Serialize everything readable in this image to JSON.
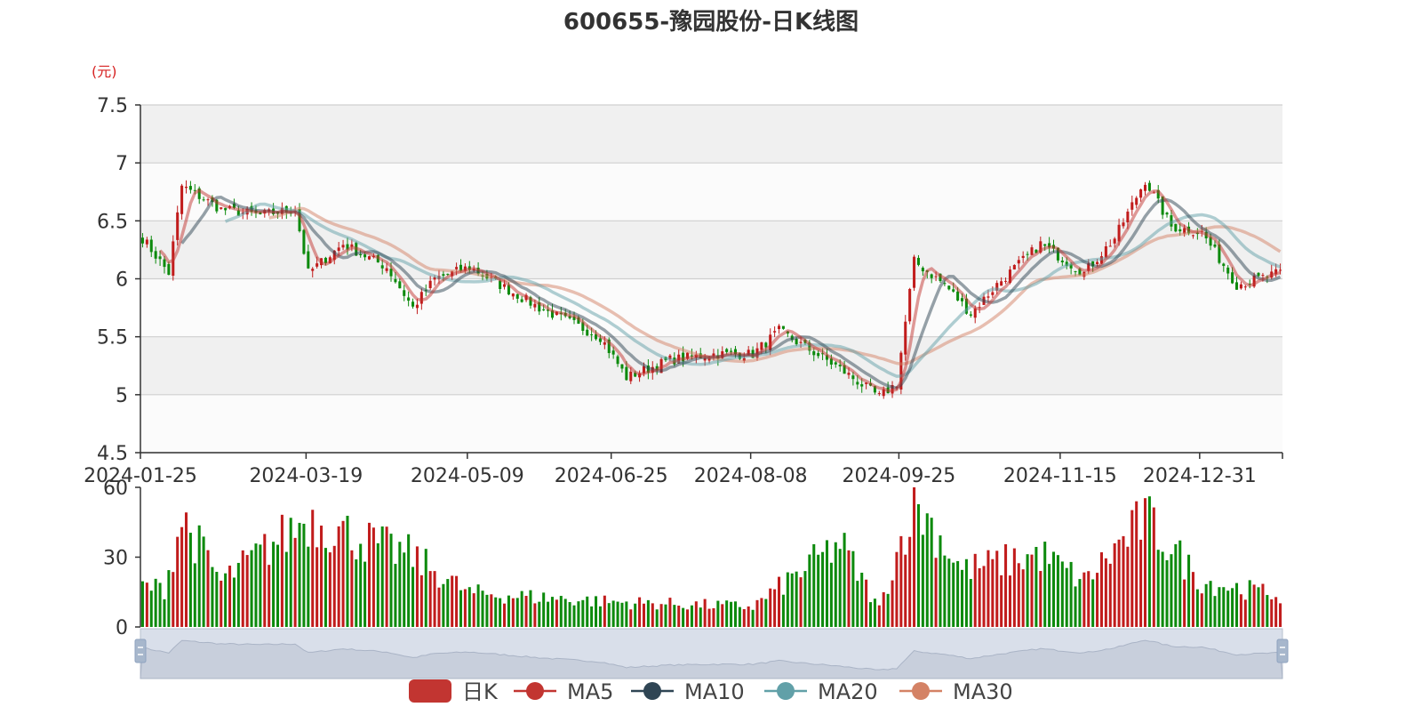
{
  "chart_data": [
    {
      "type": "candlestick",
      "title": "600655-豫园股份-日K线图",
      "unit": "(元)",
      "xaxis_ticks": [
        "2024-01-25",
        "2024-03-19",
        "2024-05-09",
        "2024-06-25",
        "2024-08-08",
        "2024-09-25",
        "2024-11-15",
        "2024-12-31"
      ],
      "yaxis_ticks": [
        "4.5",
        "5",
        "5.5",
        "6",
        "6.5",
        "7",
        "7.5"
      ],
      "ylim": [
        4.5,
        7.5
      ],
      "grid": true,
      "legend_position": "bottom",
      "legend": [
        {
          "name": "日K",
          "color": "#c23531"
        },
        {
          "name": "MA5",
          "color": "#c23531"
        },
        {
          "name": "MA10",
          "color": "#2f4554"
        },
        {
          "name": "MA20",
          "color": "#61a0a8"
        },
        {
          "name": "MA30",
          "color": "#d48265"
        }
      ],
      "colors": {
        "up": "#c11c1c",
        "down": "#0d8a0d"
      },
      "anchors": [
        {
          "date": "2024-01-25",
          "close": 6.35
        },
        {
          "date": "2024-02-02",
          "close": 6.05
        },
        {
          "date": "2024-02-07",
          "close": 6.8
        },
        {
          "date": "2024-02-20",
          "close": 6.6
        },
        {
          "date": "2024-03-04",
          "close": 6.55
        },
        {
          "date": "2024-03-14",
          "close": 6.6
        },
        {
          "date": "2024-03-19",
          "close": 6.05
        },
        {
          "date": "2024-03-29",
          "close": 6.3
        },
        {
          "date": "2024-04-12",
          "close": 6.1
        },
        {
          "date": "2024-04-22",
          "close": 5.75
        },
        {
          "date": "2024-04-29",
          "close": 6.0
        },
        {
          "date": "2024-05-09",
          "close": 6.1
        },
        {
          "date": "2024-05-31",
          "close": 5.75
        },
        {
          "date": "2024-06-20",
          "close": 5.5
        },
        {
          "date": "2024-06-28",
          "close": 5.15
        },
        {
          "date": "2024-07-12",
          "close": 5.3
        },
        {
          "date": "2024-07-26",
          "close": 5.35
        },
        {
          "date": "2024-08-08",
          "close": 5.35
        },
        {
          "date": "2024-08-16",
          "close": 5.55
        },
        {
          "date": "2024-09-04",
          "close": 5.25
        },
        {
          "date": "2024-09-18",
          "close": 4.98
        },
        {
          "date": "2024-09-24",
          "close": 5.1
        },
        {
          "date": "2024-09-30",
          "close": 6.15
        },
        {
          "date": "2024-10-09",
          "close": 5.95
        },
        {
          "date": "2024-10-17",
          "close": 5.7
        },
        {
          "date": "2024-10-25",
          "close": 5.95
        },
        {
          "date": "2024-11-08",
          "close": 6.3
        },
        {
          "date": "2024-11-22",
          "close": 6.05
        },
        {
          "date": "2024-12-03",
          "close": 6.35
        },
        {
          "date": "2024-12-12",
          "close": 6.85
        },
        {
          "date": "2024-12-20",
          "close": 6.45
        },
        {
          "date": "2024-12-31",
          "close": 6.4
        },
        {
          "date": "2025-01-10",
          "close": 5.95
        },
        {
          "date": "2025-01-24",
          "close": 6.05
        }
      ]
    },
    {
      "type": "bar",
      "name": "volume",
      "yaxis_ticks": [
        "0",
        "30",
        "60"
      ],
      "ylim": [
        0,
        60
      ],
      "volume_anchors": [
        {
          "date": "2024-01-25",
          "value": 18
        },
        {
          "date": "2024-02-01",
          "value": 17
        },
        {
          "date": "2024-02-07",
          "value": 48
        },
        {
          "date": "2024-02-20",
          "value": 20
        },
        {
          "date": "2024-03-19",
          "value": 48
        },
        {
          "date": "2024-04-10",
          "value": 36
        },
        {
          "date": "2024-04-19",
          "value": 32
        },
        {
          "date": "2024-05-09",
          "value": 15
        },
        {
          "date": "2024-06-25",
          "value": 11
        },
        {
          "date": "2024-08-08",
          "value": 9
        },
        {
          "date": "2024-09-05",
          "value": 37
        },
        {
          "date": "2024-09-18",
          "value": 8
        },
        {
          "date": "2024-09-30",
          "value": 56
        },
        {
          "date": "2024-10-15",
          "value": 25
        },
        {
          "date": "2024-11-08",
          "value": 32
        },
        {
          "date": "2024-11-22",
          "value": 20
        },
        {
          "date": "2024-12-12",
          "value": 48
        },
        {
          "date": "2024-12-31",
          "value": 20
        },
        {
          "date": "2025-01-24",
          "value": 14
        }
      ]
    }
  ]
}
